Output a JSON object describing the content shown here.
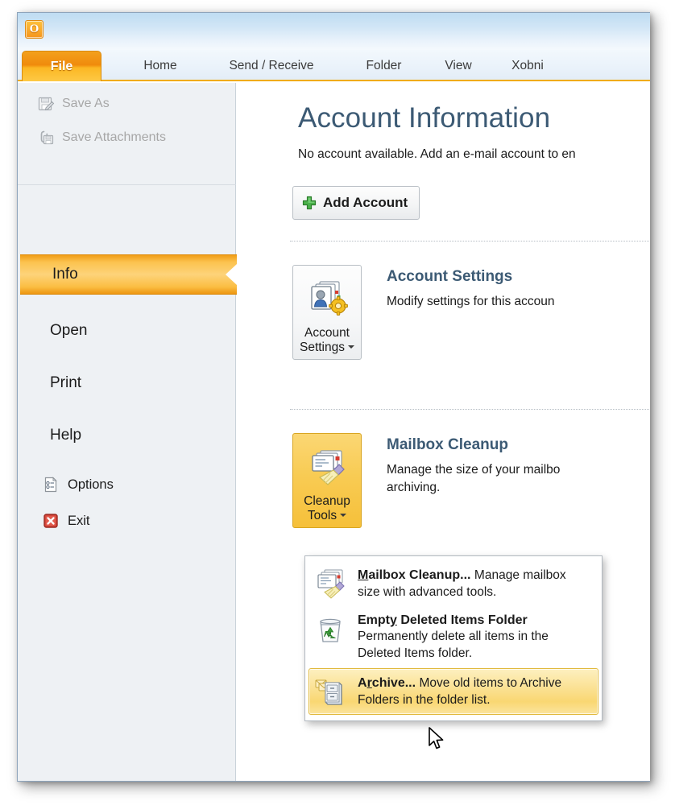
{
  "window": {
    "app_logo_glyph": "O",
    "accent_orange": "#f0ab00",
    "heading_blue": "#3c5a74",
    "highlight_yellow": "#f9d772",
    "titlebar_blue": "#bedcf2"
  },
  "ribbon": {
    "tabs": [
      {
        "label": "File",
        "icon": "file-tab",
        "active": true
      },
      {
        "label": "Home",
        "icon": "home-tab",
        "active": false
      },
      {
        "label": "Send / Receive",
        "icon": "send-receive-tab",
        "active": false
      },
      {
        "label": "Folder",
        "icon": "folder-tab",
        "active": false
      },
      {
        "label": "View",
        "icon": "view-tab",
        "active": false
      },
      {
        "label": "Xobni",
        "icon": "xobni-tab",
        "active": false
      }
    ]
  },
  "sidebar": {
    "commands_top": [
      {
        "label": "Save As",
        "icon": "save-as-icon",
        "disabled": true
      },
      {
        "label": "Save Attachments",
        "icon": "save-attachments-icon",
        "disabled": true
      }
    ],
    "nav": [
      {
        "label": "Info",
        "icon": "info-item",
        "selected": true
      },
      {
        "label": "Open",
        "icon": "open-item",
        "selected": false
      },
      {
        "label": "Print",
        "icon": "print-item",
        "selected": false
      },
      {
        "label": "Help",
        "icon": "help-item",
        "selected": false
      }
    ],
    "commands_bottom": [
      {
        "label": "Options",
        "icon": "options-icon",
        "disabled": false
      },
      {
        "label": "Exit",
        "icon": "exit-icon",
        "disabled": false
      }
    ]
  },
  "main": {
    "title": "Account Information",
    "no_account_text": "No account available. Add an e-mail account to en",
    "add_account_label": "Add Account",
    "add_account_icon": "green-plus-icon",
    "sections": [
      {
        "button_caption_line1": "Account",
        "button_caption_line2": "Settings",
        "button_icon": "account-settings-icon",
        "button_state": "normal",
        "heading": "Account Settings",
        "description": "Modify settings for this accoun"
      },
      {
        "button_caption_line1": "Cleanup",
        "button_caption_line2": "Tools",
        "button_icon": "cleanup-tools-icon",
        "button_state": "active",
        "heading": "Mailbox Cleanup",
        "description": "Manage the size of your mailbo\narchiving."
      }
    ]
  },
  "dropdown": {
    "items": [
      {
        "icon": "mailbox-cleanup-icon",
        "title_pre": "",
        "title_key": "M",
        "title_post": "ailbox Cleanup...",
        "desc": "Manage mailbox size with advanced tools.",
        "highlighted": false
      },
      {
        "icon": "recycle-bin-icon",
        "title_pre": "Empt",
        "title_key": "y",
        "title_post": " Deleted Items Folder",
        "desc": "Permanently delete all items in the Deleted Items folder.",
        "highlighted": false
      },
      {
        "icon": "archive-icon",
        "title_pre": "A",
        "title_key": "r",
        "title_post": "chive...",
        "desc": "Move old items to Archive Folders in the folder list.",
        "highlighted": true
      }
    ]
  },
  "cursor": {
    "icon": "mouse-pointer-icon"
  }
}
